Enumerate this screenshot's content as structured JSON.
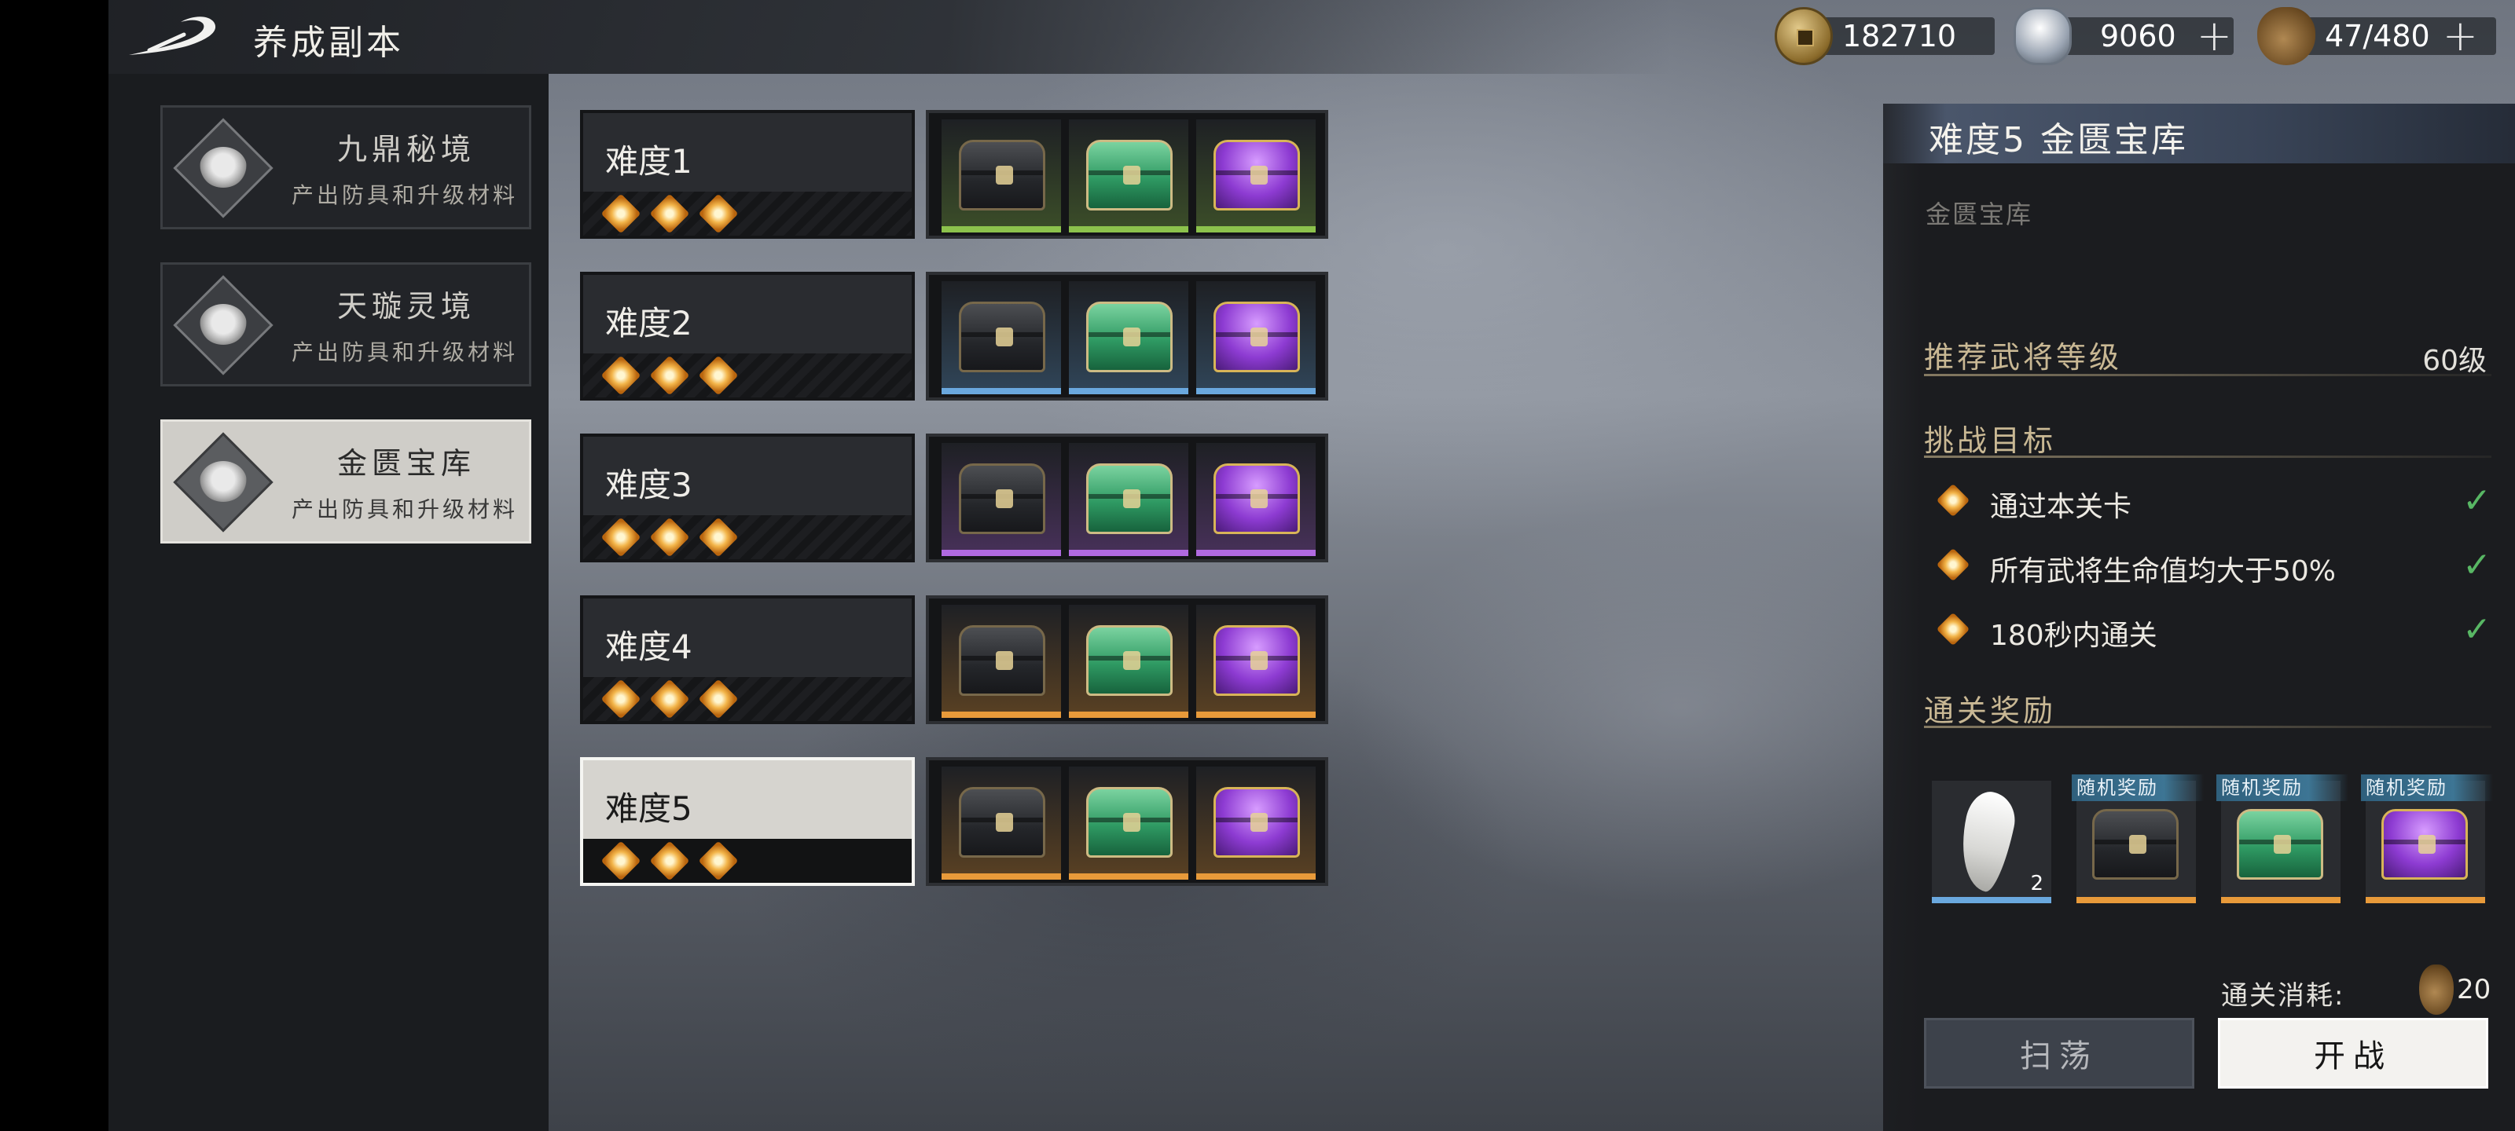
{
  "header": {
    "title": "养成副本",
    "currencies": [
      {
        "icon": "copper-coin-icon",
        "value": "182710",
        "has_plus": false
      },
      {
        "icon": "silver-ingot-icon",
        "value": "9060",
        "has_plus": true,
        "plus": "+"
      },
      {
        "icon": "stamina-bag-icon",
        "value": "47/480",
        "has_plus": true,
        "plus": "+"
      }
    ]
  },
  "dungeons": [
    {
      "name": "九鼎秘境",
      "desc": "产出防具和升级材料",
      "active": false
    },
    {
      "name": "天璇灵境",
      "desc": "产出防具和升级材料",
      "active": false
    },
    {
      "name": "金匮宝库",
      "desc": "产出防具和升级材料",
      "active": true
    }
  ],
  "difficulties": [
    {
      "name": "难度1",
      "stars": 3,
      "tier_color": "#8cc24c",
      "active": false
    },
    {
      "name": "难度2",
      "stars": 3,
      "tier_color": "#6aa8de",
      "active": false
    },
    {
      "name": "难度3",
      "stars": 3,
      "tier_color": "#b06ae0",
      "active": false
    },
    {
      "name": "难度4",
      "stars": 3,
      "tier_color": "#e89a3a",
      "active": false
    },
    {
      "name": "难度5",
      "stars": 3,
      "tier_color": "#e89a3a",
      "active": true
    }
  ],
  "chest_types": [
    "black-chest-icon",
    "green-chest-icon",
    "purple-chest-icon"
  ],
  "detail": {
    "title": "难度5   金匮宝库",
    "subtitle": "金匮宝库",
    "recommend_label": "推荐武将等级",
    "recommend_value": "60级",
    "objectives_title": "挑战目标",
    "objectives": [
      {
        "text": "通过本关卡",
        "done": true
      },
      {
        "text": "所有武将生命值均大于50%",
        "done": true
      },
      {
        "text": "180秒内通关",
        "done": true
      }
    ],
    "check": "✓",
    "rewards_title": "通关奖励",
    "rewards": [
      {
        "icon": "tusk-material-icon",
        "count": "2",
        "tag": "",
        "bar_color": "#6aa8de"
      },
      {
        "icon": "black-chest-icon",
        "count": "",
        "tag": "随机奖励",
        "bar_color": "#e89a3a"
      },
      {
        "icon": "green-chest-icon",
        "count": "",
        "tag": "随机奖励",
        "bar_color": "#e89a3a"
      },
      {
        "icon": "purple-chest-icon",
        "count": "",
        "tag": "随机奖励",
        "bar_color": "#e89a3a"
      }
    ],
    "cost_label": "通关消耗:",
    "cost_value": "20",
    "sweep_label": "扫荡",
    "fight_label": "开战"
  }
}
